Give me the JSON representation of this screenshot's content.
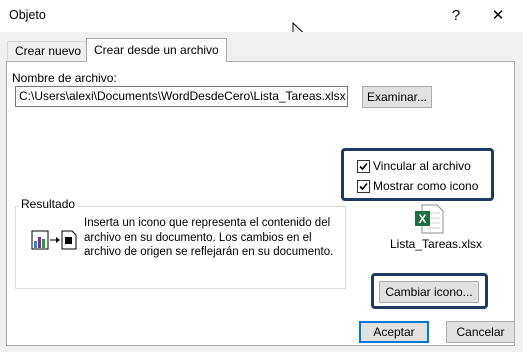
{
  "window": {
    "title": "Objeto",
    "help_glyph": "?",
    "close_glyph": "✕"
  },
  "tabs": [
    {
      "label": "Crear nuevo",
      "active": false
    },
    {
      "label": "Crear desde un archivo",
      "active": true
    }
  ],
  "file": {
    "label": "Nombre de archivo:",
    "value": "C:\\Users\\alexi\\Documents\\WordDesdeCero\\Lista_Tareas.xlsx",
    "browse_label": "Examinar..."
  },
  "options": {
    "link_label": "Vincular al archivo",
    "link_checked": true,
    "show_icon_label": "Mostrar como icono",
    "show_icon_checked": true
  },
  "result": {
    "legend": "Resultado",
    "text": "Inserta un icono que representa el contenido del archivo en su documento. Los cambios en el archivo de origen se reflejarán en su documento."
  },
  "icon_preview": {
    "icon": "excel-file-icon",
    "caption": "Lista_Tareas.xlsx",
    "change_label": "Cambiar icono..."
  },
  "footer": {
    "ok_label": "Aceptar",
    "cancel_label": "Cancelar"
  },
  "colors": {
    "highlight": "#1f3a60",
    "excel_green": "#1d6f42",
    "focus_blue": "#0078d7"
  }
}
